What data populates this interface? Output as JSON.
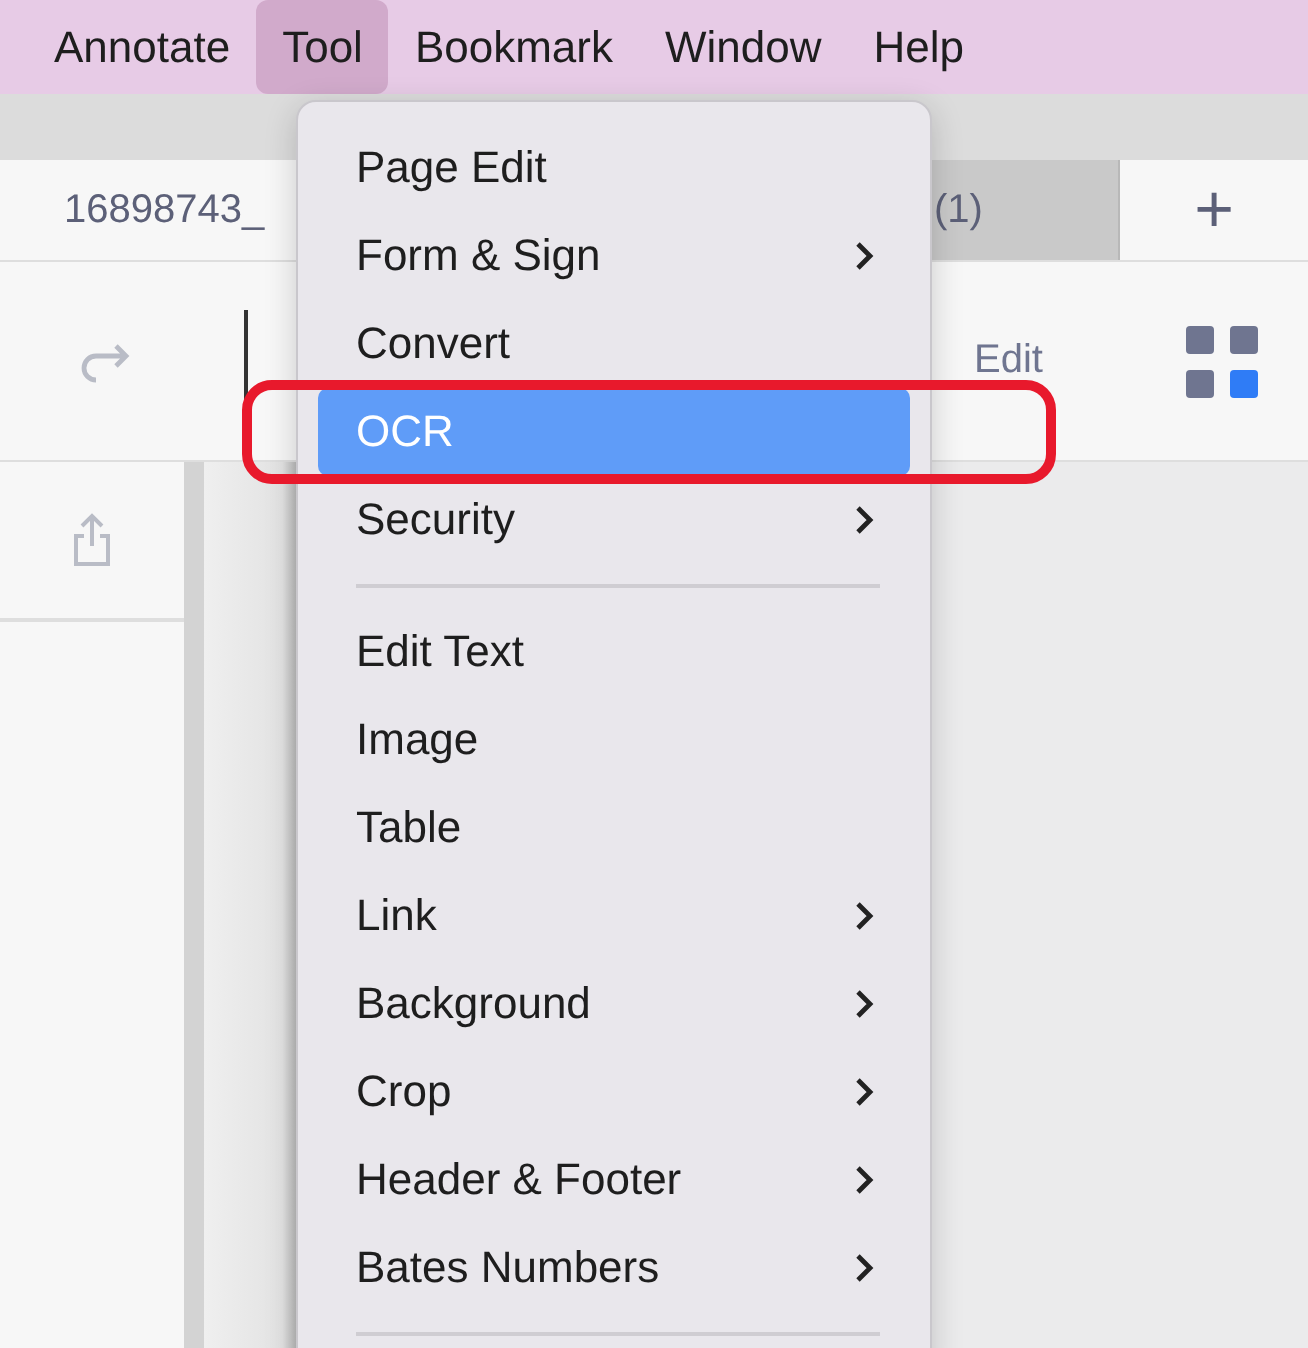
{
  "menu_bar": {
    "items": [
      {
        "label": "Annotate",
        "selected": false
      },
      {
        "label": "Tool",
        "selected": true
      },
      {
        "label": "Bookmark",
        "selected": false
      },
      {
        "label": "Window",
        "selected": false
      },
      {
        "label": "Help",
        "selected": false
      }
    ]
  },
  "tabs": [
    {
      "label": "16898743_",
      "selected": true
    },
    {
      "label": "(1)",
      "selected": false
    }
  ],
  "new_tab_button": "+",
  "toolbar": {
    "edit_label": "Edit"
  },
  "tool_menu": {
    "items": [
      {
        "kind": "item",
        "label": "Page Edit",
        "submenu": false,
        "selected": false
      },
      {
        "kind": "item",
        "label": "Form & Sign",
        "submenu": true,
        "selected": false
      },
      {
        "kind": "item",
        "label": "Convert",
        "submenu": false,
        "selected": false
      },
      {
        "kind": "item",
        "label": "OCR",
        "submenu": false,
        "selected": true
      },
      {
        "kind": "item",
        "label": "Security",
        "submenu": true,
        "selected": false
      },
      {
        "kind": "separator"
      },
      {
        "kind": "item",
        "label": "Edit Text",
        "submenu": false,
        "selected": false
      },
      {
        "kind": "item",
        "label": "Image",
        "submenu": false,
        "selected": false
      },
      {
        "kind": "item",
        "label": "Table",
        "submenu": false,
        "selected": false
      },
      {
        "kind": "item",
        "label": "Link",
        "submenu": true,
        "selected": false
      },
      {
        "kind": "item",
        "label": "Background",
        "submenu": true,
        "selected": false
      },
      {
        "kind": "item",
        "label": "Crop",
        "submenu": true,
        "selected": false
      },
      {
        "kind": "item",
        "label": "Header & Footer",
        "submenu": true,
        "selected": false
      },
      {
        "kind": "item",
        "label": "Bates Numbers",
        "submenu": true,
        "selected": false
      },
      {
        "kind": "separator"
      }
    ]
  }
}
